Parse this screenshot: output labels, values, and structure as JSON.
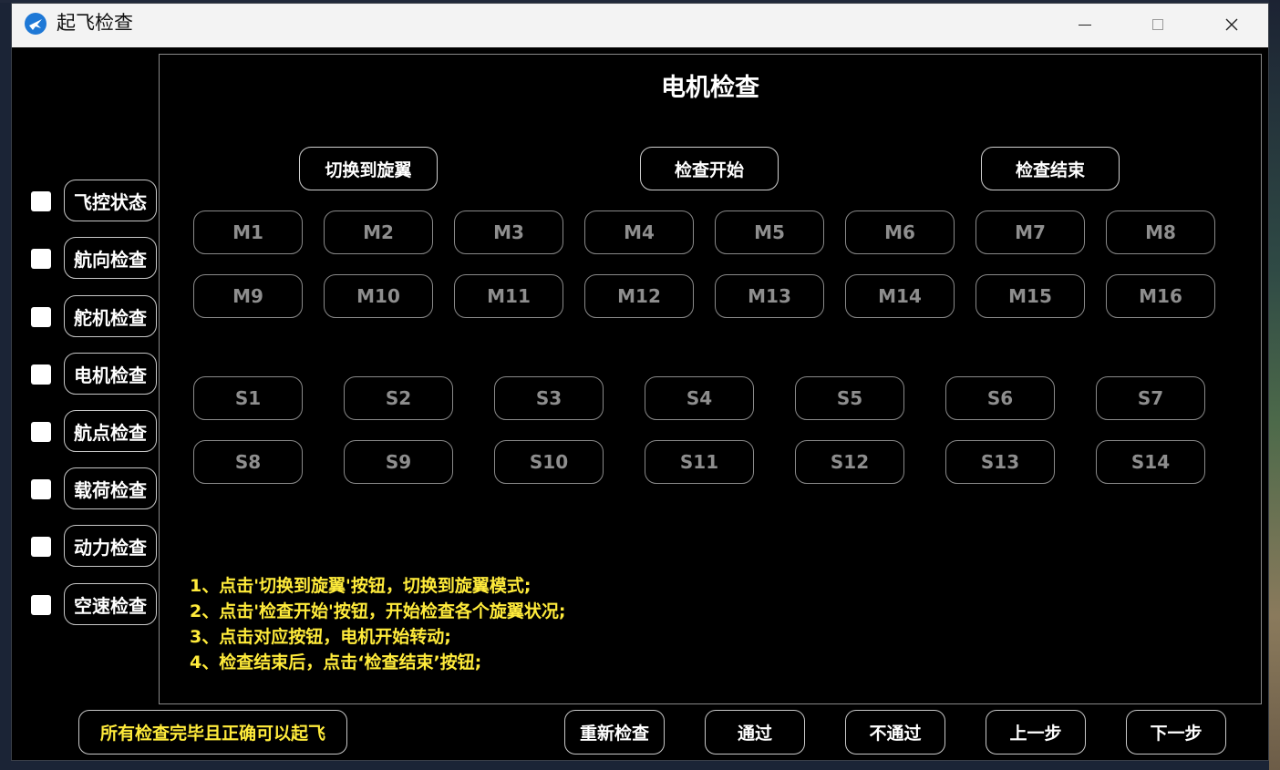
{
  "window": {
    "title": "起飞检查"
  },
  "sidebar": {
    "items": [
      {
        "label": "飞控状态",
        "checked": false
      },
      {
        "label": "航向检查",
        "checked": false
      },
      {
        "label": "舵机检查",
        "checked": false
      },
      {
        "label": "电机检查",
        "checked": false
      },
      {
        "label": "航点检查",
        "checked": false
      },
      {
        "label": "载荷检查",
        "checked": false
      },
      {
        "label": "动力检查",
        "checked": false
      },
      {
        "label": "空速检查",
        "checked": false
      }
    ]
  },
  "panel": {
    "title": "电机检查",
    "controls": {
      "switch": "切换到旋翼",
      "start": "检查开始",
      "end": "检查结束"
    },
    "motors": [
      "M1",
      "M2",
      "M3",
      "M4",
      "M5",
      "M6",
      "M7",
      "M8",
      "M9",
      "M10",
      "M11",
      "M12",
      "M13",
      "M14",
      "M15",
      "M16"
    ],
    "servos": [
      "S1",
      "S2",
      "S3",
      "S4",
      "S5",
      "S6",
      "S7",
      "S8",
      "S9",
      "S10",
      "S11",
      "S12",
      "S13",
      "S14"
    ],
    "instructions": [
      "1、点击'切换到旋翼'按钮，切换到旋翼模式;",
      "2、点击'检查开始'按钮，开始检查各个旋翼状况;",
      "3、点击对应按钮，电机开始转动;",
      "4、检查结束后，点击‘检查结束’按钮;"
    ]
  },
  "footer": {
    "status": "所有检查完毕且正确可以起飞",
    "recheck": "重新检查",
    "pass": "通过",
    "fail": "不通过",
    "prev": "上一步",
    "next": "下一步"
  },
  "colors": {
    "instruction": "#ffeb3b",
    "background": "#000000",
    "disabled_text": "#8e8e8e"
  }
}
